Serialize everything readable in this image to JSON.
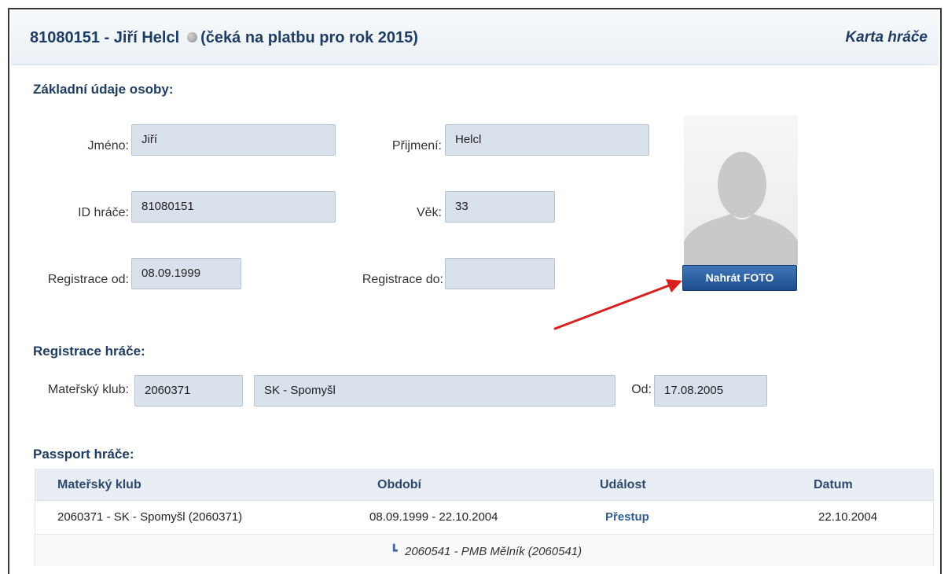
{
  "header": {
    "title": "81080151 - Jiří Helcl",
    "status": "(čeká na platbu pro rok 2015)",
    "card_link": "Karta hráče"
  },
  "personal": {
    "section_title": "Základní údaje osoby:",
    "first_name_label": "Jméno:",
    "first_name_value": "Jiří",
    "last_name_label": "Přijmení:",
    "last_name_value": "Helcl",
    "player_id_label": "ID hráče:",
    "player_id_value": "81080151",
    "age_label": "Věk:",
    "age_value": "33",
    "reg_from_label": "Registrace od:",
    "reg_from_value": "08.09.1999",
    "reg_to_label": "Registrace do:",
    "reg_to_value": "",
    "upload_photo_label": "Nahrát FOTO"
  },
  "registration": {
    "section_title": "Registrace hráče:",
    "club_label": "Mateřský klub:",
    "club_id": "2060371",
    "club_name": "SK - Spomyšl",
    "from_label": "Od:",
    "from_value": "17.08.2005"
  },
  "passport": {
    "section_title": "Passport hráče:",
    "columns": [
      "Mateřský klub",
      "Období",
      "Událost",
      "Datum"
    ],
    "rows": [
      {
        "club": "2060371 - SK - Spomyšl (2060371)",
        "period": "08.09.1999 - 22.10.2004",
        "event": "Přestup",
        "date": "22.10.2004"
      }
    ],
    "sub_row": "2060541 - PMB Mělník (2060541)"
  },
  "colors": {
    "title": "#1f3d63",
    "field_bg": "#d8e1ec",
    "button": "#1d4d8c",
    "arrow": "#d9201f"
  }
}
